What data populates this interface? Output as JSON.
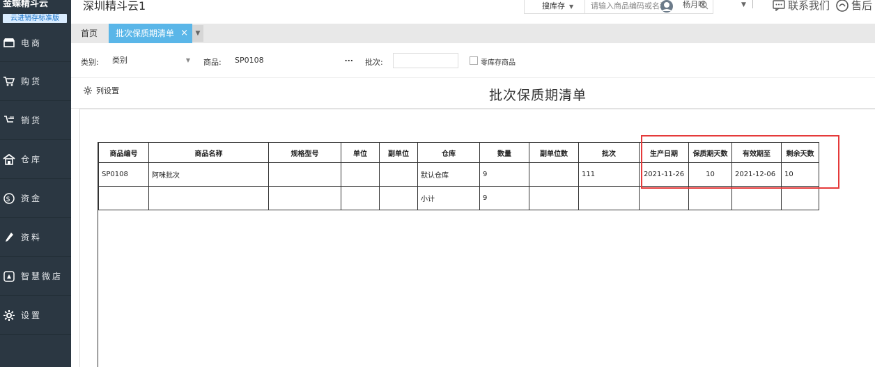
{
  "sidebar": {
    "brand": "金蝶精斗云",
    "edition": "云进销存标准版",
    "items": [
      {
        "label": "电商",
        "icon": "shop-icon"
      },
      {
        "label": "购货",
        "icon": "cart-icon"
      },
      {
        "label": "销货",
        "icon": "sales-icon"
      },
      {
        "label": "仓库",
        "icon": "warehouse-icon"
      },
      {
        "label": "资金",
        "icon": "money-icon"
      },
      {
        "label": "资料",
        "icon": "pen-icon"
      },
      {
        "label": "智慧微店",
        "icon": "mini-store-icon"
      },
      {
        "label": "设置",
        "icon": "gear-icon"
      }
    ]
  },
  "header": {
    "title": "深圳精斗云1",
    "search_scope": "搜库存",
    "search_placeholder": "请输入商品编码或名称",
    "user_name": "杨月咪",
    "contact": "联系我们",
    "aftersale": "售后"
  },
  "tabs": {
    "home": "首页",
    "active": "批次保质期清单",
    "close": "×",
    "more": "▼"
  },
  "filters": {
    "category_label": "类别:",
    "category_value": "类别",
    "product_label": "商品:",
    "product_value": "SP0108",
    "batch_label": "批次:",
    "batch_value": "",
    "zero_stock_label": "零库存商品"
  },
  "report": {
    "column_settings": "列设置",
    "title": "批次保质期清单",
    "columns": [
      "商品编号",
      "商品名称",
      "规格型号",
      "单位",
      "副单位",
      "仓库",
      "数量",
      "副单位数",
      "批次",
      "生产日期",
      "保质期天数",
      "有效期至",
      "剩余天数"
    ],
    "rows": [
      [
        "SP0108",
        "阿咪批次",
        "",
        "",
        "",
        "默认仓库",
        "9",
        "",
        "111",
        "2021-11-26",
        "10",
        "2021-12-06",
        "10"
      ],
      [
        "",
        "",
        "",
        "",
        "",
        "小计",
        "9",
        "",
        "",
        "",
        "",
        "",
        ""
      ]
    ]
  },
  "colors": {
    "sidebar_bg": "#2b3742",
    "tab_active": "#5ab6e8",
    "highlight": "#e53a3a"
  }
}
